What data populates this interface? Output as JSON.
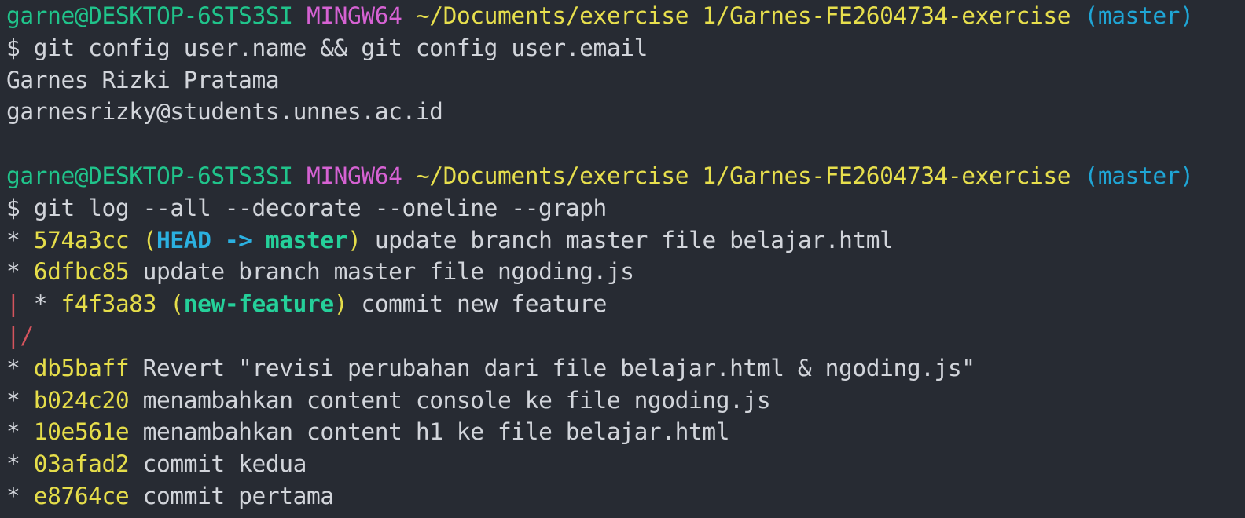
{
  "prompts": [
    {
      "user_host": "garne@DESKTOP-6STS3SI",
      "system": "MINGW64",
      "path": "~/Documents/exercise 1/Garnes-FE2604734-exercise",
      "branch": "(master)",
      "command": "$ git config user.name && git config user.email"
    },
    {
      "user_host": "garne@DESKTOP-6STS3SI",
      "system": "MINGW64",
      "path": "~/Documents/exercise 1/Garnes-FE2604734-exercise",
      "branch": "(master)",
      "command": "$ git log --all --decorate --oneline --graph"
    }
  ],
  "config_output": [
    "Garnes Rizki Pratama",
    "garnesrizky@students.unnes.ac.id"
  ],
  "log": [
    {
      "graph": "* ",
      "hash": "574a3cc",
      "ref_open": "(",
      "ref_head": "HEAD -> ",
      "ref_branch": "master",
      "ref_close": ")",
      "message": " update branch master file belajar.html"
    },
    {
      "graph": "* ",
      "hash": "6dfbc85",
      "message": " update branch master file ngoding.js"
    },
    {
      "graph_red": "| ",
      "graph": "* ",
      "hash": "f4f3a83",
      "ref_open": "(",
      "ref_branch": "new-feature",
      "ref_close": ")",
      "message": " commit new feature"
    },
    {
      "graph_red": "|/"
    },
    {
      "graph": "* ",
      "hash": "db5baff",
      "message": " Revert \"revisi perubahan dari file belajar.html & ngoding.js\""
    },
    {
      "graph": "* ",
      "hash": "b024c20",
      "message": " menambahkan content console ke file ngoding.js"
    },
    {
      "graph": "* ",
      "hash": "10e561e",
      "message": " menambahkan content h1 ke file belajar.html"
    },
    {
      "graph": "* ",
      "hash": "03afad2",
      "message": " commit kedua"
    },
    {
      "graph": "* ",
      "hash": "e8764ce",
      "message": " commit pertama"
    }
  ],
  "colors": {
    "background": "#272b33",
    "user_host": "#20c48b",
    "system": "#d662d3",
    "path": "#e7df4d",
    "branch": "#1fa6d6",
    "graph_branch_line": "#d4545d"
  }
}
